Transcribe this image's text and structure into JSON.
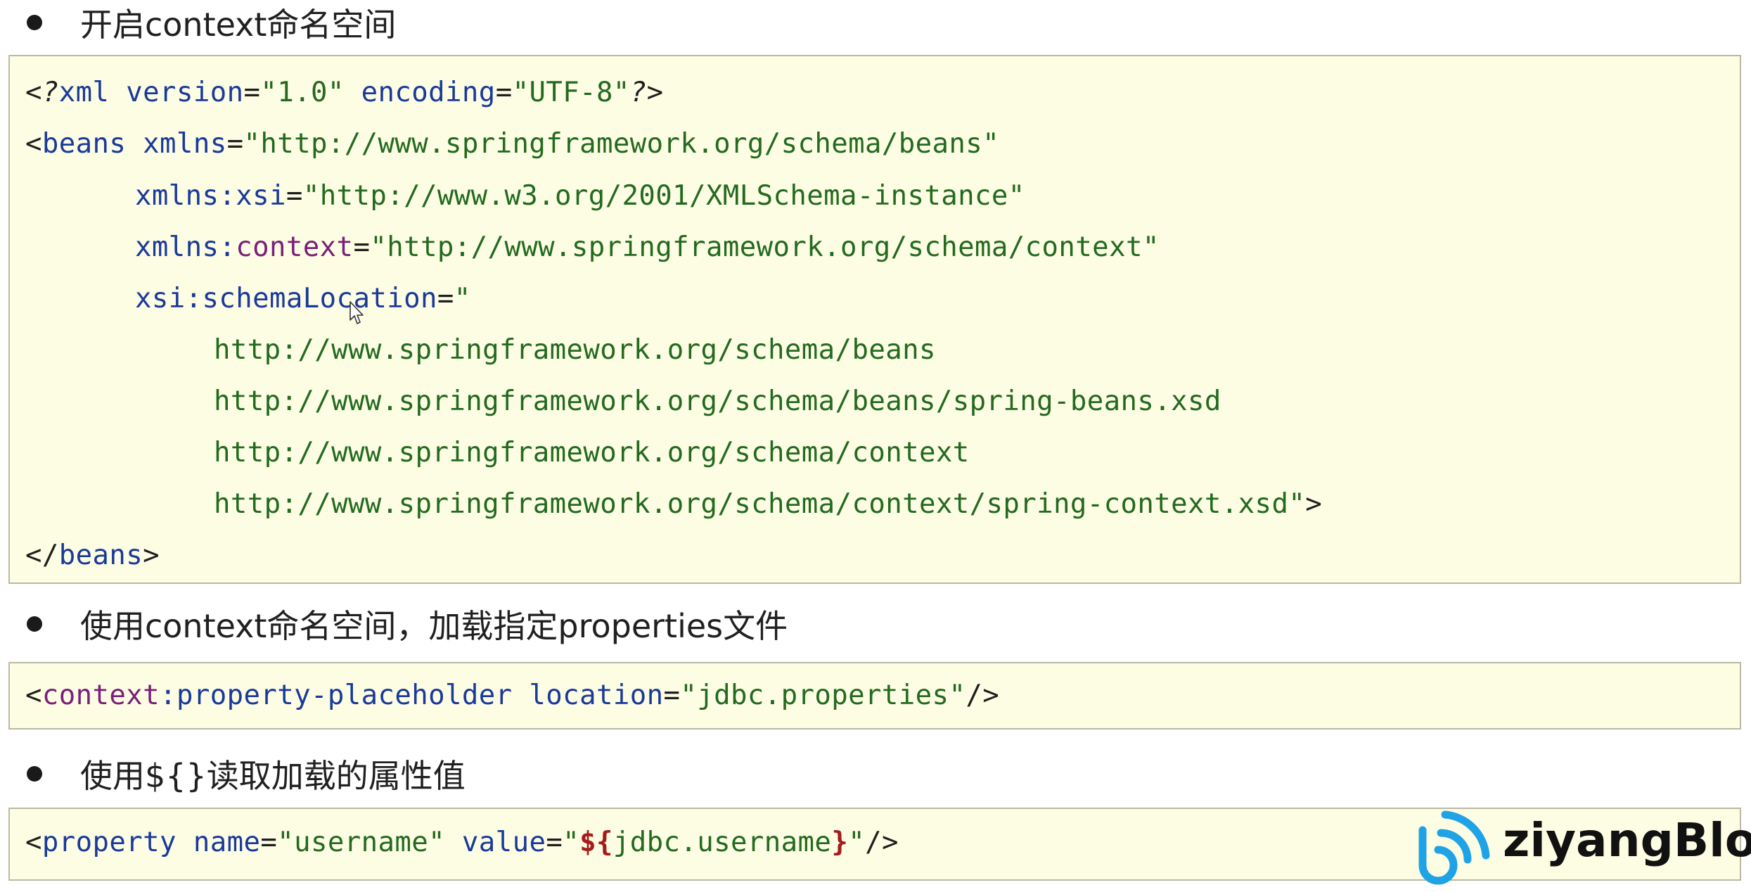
{
  "sections": [
    {
      "heading": "开启context命名空间"
    },
    {
      "heading": "使用context命名空间，加载指定properties文件"
    },
    {
      "heading": "使用${}读取加载的属性值"
    }
  ],
  "code1": {
    "l1": {
      "a": "<",
      "b": "?",
      "c": "xml",
      "d": " version",
      "e": "=",
      "f": "\"1.0\"",
      "g": " encoding",
      "h": "=",
      "i": "\"UTF-8\"",
      "j": "?",
      "k": ">"
    },
    "l2": {
      "a": "<",
      "b": "beans",
      "c": " xmlns",
      "d": "=",
      "e": "\"http://www.springframework.org/schema/beans\""
    },
    "l3": {
      "a": "xmlns:xsi",
      "b": "=",
      "c": "\"http://www.w3.org/2001/XMLSchema-instance\""
    },
    "l4": {
      "a": "xmlns:",
      "b": "context",
      "c": "=",
      "d": "\"http://www.springframework.org/schema/context\""
    },
    "l5": {
      "a": "xsi:schemaLocation",
      "b": "=",
      "c": "\""
    },
    "l6": "http://www.springframework.org/schema/beans",
    "l7": "http://www.springframework.org/schema/beans/spring-beans.xsd",
    "l8": "http://www.springframework.org/schema/context",
    "l9": {
      "a": "http://www.springframework.org/schema/context/spring-context.xsd\"",
      "b": ">"
    },
    "l10": {
      "a": "</",
      "b": "beans",
      "c": ">"
    }
  },
  "code2": {
    "a": "<",
    "b": "context",
    "c": ":property-placeholder",
    "d": " location",
    "e": "=",
    "f": "\"jdbc.properties\"",
    "g": "/>"
  },
  "code3": {
    "a": "<",
    "b": "property",
    "c": " name",
    "d": "=",
    "e": "\"username\"",
    "f": " value",
    "g": "=",
    "h": "\"",
    "i": "${",
    "j": "jdbc.username",
    "k": "}",
    "l": "\"",
    "m": "/>"
  },
  "watermark": {
    "text": "ziyangBlog",
    "icon": "wifi-signal-logo-icon",
    "color": "#1fa3e6"
  },
  "colors": {
    "code_bg": "#fdfde4",
    "tag": "#1a3a9a",
    "value": "#236a1f",
    "namespace": "#7a1f7a",
    "expression": "#a41c1c"
  }
}
